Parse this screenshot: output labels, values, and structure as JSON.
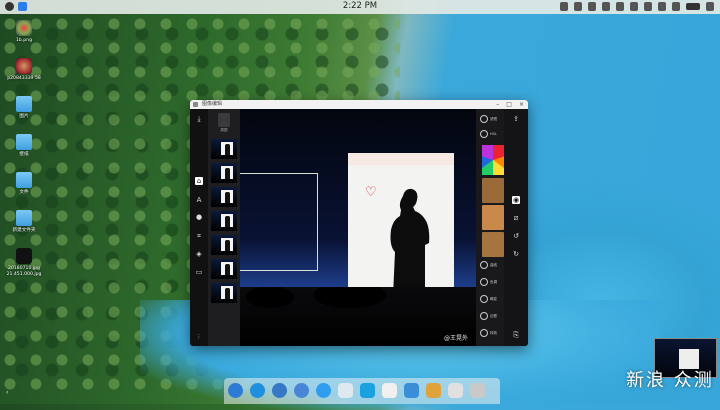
{
  "menubar": {
    "clock": "2:22 PM"
  },
  "desktop_icons": [
    {
      "label": "1b.png",
      "kind": "img1"
    },
    {
      "label": "p20843339\n58",
      "kind": "img2"
    },
    {
      "label": "图片",
      "kind": "folder"
    },
    {
      "label": "壁纸",
      "kind": "folder"
    },
    {
      "label": "文件",
      "kind": "folder"
    },
    {
      "label": "新建文件夹",
      "kind": "folder"
    },
    {
      "label": "20180710.jpg\n21.451.000.jpg",
      "kind": "dark"
    }
  ],
  "window": {
    "title": "图像编辑",
    "thumb_top_label": "原图",
    "left_tools": [
      "download-icon",
      "home-icon",
      "text-icon",
      "sticker-icon",
      "crop-icon",
      "layers-icon",
      "frame-icon"
    ],
    "thumbs": [
      "",
      "",
      "",
      "",
      "",
      "",
      ""
    ],
    "canvas_watermark": "@王晃外",
    "right_panel": {
      "top_rows": [
        {
          "label": "滤镜"
        },
        {
          "label": "HSL"
        }
      ],
      "swatches": [
        {
          "label": "",
          "color": "#9a6a38"
        },
        {
          "label": "",
          "color": "#c9894a"
        },
        {
          "label": "",
          "color": "#a5743f"
        }
      ],
      "bottom_rows": [
        {
          "label": "曲线"
        },
        {
          "label": "色调"
        },
        {
          "label": "畸变"
        },
        {
          "label": "边框"
        },
        {
          "label": "特效"
        }
      ]
    },
    "right_tools": [
      "share-icon",
      "camera-icon",
      "eraser-icon",
      "undo-icon",
      "redo-icon",
      "export-icon"
    ]
  },
  "dock_colors": [
    "#2e7bd6",
    "#1f8fe0",
    "#3478c6",
    "#4a86d8",
    "#2f9cf0",
    "#dfe8ef",
    "#19a1e0",
    "#f0f0f0",
    "#3a8ed8",
    "#e0a33a",
    "#e0e0e0",
    "#c9c9c9"
  ],
  "sidebar_toggle": "‹",
  "watermark": "新浪 众测"
}
